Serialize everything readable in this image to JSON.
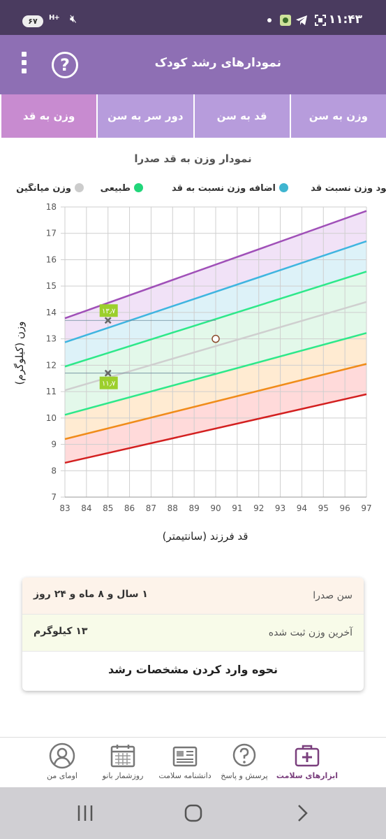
{
  "status_bar": {
    "time": "۱۱:۴۳",
    "battery": "۶۷",
    "network": "H+"
  },
  "app_bar": {
    "title": "نمودارهای رشد کودک",
    "help_glyph": "?"
  },
  "tabs": [
    {
      "label": "وزن به سن",
      "active": false
    },
    {
      "label": "قد به سن",
      "active": false
    },
    {
      "label": "دور سر به سن",
      "active": false
    },
    {
      "label": "وزن به قد",
      "active": true
    }
  ],
  "chart_data": {
    "type": "line",
    "title": "نمودار وزن به قد صدرا",
    "xlabel": "قد فرزند (سانتیمتر)",
    "ylabel": "وزن (کیلوگرم)",
    "xlim": [
      83,
      97
    ],
    "ylim": [
      7,
      18
    ],
    "x_ticks": [
      "83",
      "84",
      "85",
      "86",
      "87",
      "88",
      "89",
      "90",
      "91",
      "92",
      "93",
      "94",
      "95",
      "96",
      "97"
    ],
    "y_ticks": [
      "7",
      "8",
      "9",
      "10",
      "11",
      "12",
      "13",
      "14",
      "15",
      "16",
      "17",
      "18"
    ],
    "grid": true,
    "legend": [
      {
        "label": "کمبود وزن نسبت قد",
        "color": "#f5a623"
      },
      {
        "label": "اضافه وزن نسبت به قد",
        "color": "#3fb5d0"
      },
      {
        "label": "طبیعی",
        "color": "#21d67a"
      },
      {
        "label": "وزن میانگین",
        "color": "#cccccc"
      }
    ],
    "series": [
      {
        "color": "#d32020",
        "x": [
          83,
          97
        ],
        "y": [
          8.3,
          10.9
        ]
      },
      {
        "color": "#f08c1a",
        "x": [
          83,
          97
        ],
        "y": [
          9.2,
          12.05
        ]
      },
      {
        "color": "#2ee88a",
        "x": [
          83,
          97
        ],
        "y": [
          10.12,
          13.22
        ]
      },
      {
        "color": "#cfcfcf",
        "x": [
          83,
          97
        ],
        "y": [
          11.05,
          14.4
        ]
      },
      {
        "color": "#2ee88a",
        "x": [
          83,
          97
        ],
        "y": [
          11.95,
          15.55
        ]
      },
      {
        "color": "#3fb5e0",
        "x": [
          83,
          97
        ],
        "y": [
          12.87,
          16.7
        ]
      },
      {
        "color": "#a050b8",
        "x": [
          83,
          97
        ],
        "y": [
          13.78,
          17.85
        ]
      }
    ],
    "bands": [
      {
        "color": "#ffdada",
        "between": [
          0,
          1
        ]
      },
      {
        "color": "#ffebd2",
        "between": [
          1,
          2
        ]
      },
      {
        "color": "#e3f8ea",
        "between": [
          2,
          3
        ]
      },
      {
        "color": "#e3f8ea",
        "between": [
          3,
          4
        ]
      },
      {
        "color": "#ddf2f8",
        "between": [
          4,
          5
        ]
      },
      {
        "color": "#f1e2f7",
        "between": [
          5,
          6
        ]
      }
    ],
    "point": {
      "x": 90,
      "y": 13
    },
    "markers": [
      {
        "x": 85,
        "y": 13.7,
        "label": "۱۳٫۷"
      },
      {
        "x": 85,
        "y": 11.7,
        "label": "۱۱٫۷"
      }
    ]
  },
  "info_card": {
    "age_label": "سن صدرا",
    "age_value": "۱ سال و ۸ ماه و ۲۴ روز",
    "weight_label": "آخرین وزن ثبت شده",
    "weight_value": "۱۳ کیلوگرم",
    "howto_label": "نحوه وارد کردن مشخصات رشد"
  },
  "bottom_nav": [
    {
      "label": "ابزارهای سلامت",
      "icon": "first-aid-kit-icon",
      "active": true
    },
    {
      "label": "پرسش و پاسخ",
      "icon": "question-bubble-icon",
      "active": false
    },
    {
      "label": "دانشنامه سلامت",
      "icon": "newspaper-icon",
      "active": false
    },
    {
      "label": "روزشمار بانو",
      "icon": "calendar-icon",
      "active": false
    },
    {
      "label": "اومای من",
      "icon": "profile-icon",
      "active": false
    }
  ]
}
